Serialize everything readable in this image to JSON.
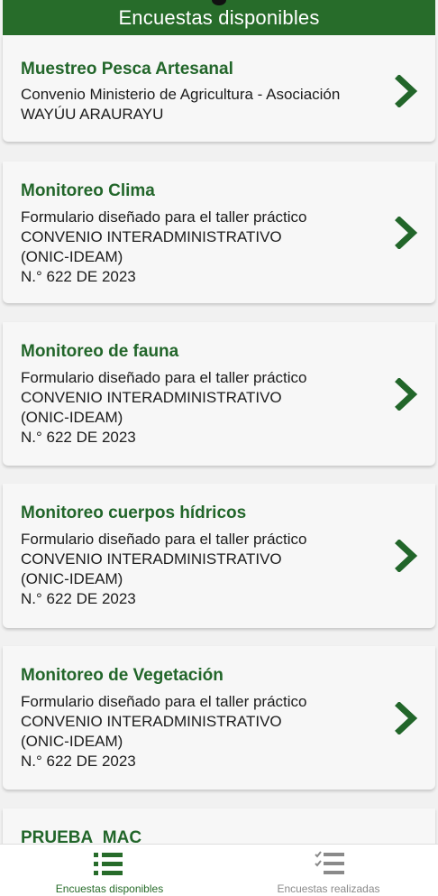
{
  "header": {
    "title": "Encuestas disponibles"
  },
  "surveys": [
    {
      "title": "Muestreo Pesca Artesanal",
      "description": "Convenio Ministerio de Agricultura - Asociación\nWAYÚU ARAURAYU"
    },
    {
      "title": "Monitoreo Clima",
      "description": "Formulario diseñado para el taller práctico\nCONVENIO INTERADMINISTRATIVO\n(ONIC-IDEAM)\nN.° 622 DE 2023"
    },
    {
      "title": "Monitoreo de fauna",
      "description": "Formulario diseñado para el taller práctico\nCONVENIO INTERADMINISTRATIVO\n(ONIC-IDEAM)\nN.° 622 DE 2023"
    },
    {
      "title": "Monitoreo cuerpos hídricos",
      "description": "Formulario diseñado para el taller práctico\nCONVENIO INTERADMINISTRATIVO\n(ONIC-IDEAM)\nN.° 622 DE 2023"
    },
    {
      "title": "Monitoreo de Vegetación",
      "description": "Formulario diseñado para el taller práctico\nCONVENIO INTERADMINISTRATIVO\n(ONIC-IDEAM)\nN.° 622 DE 2023"
    },
    {
      "title": "PRUEBA_MAC",
      "description": ""
    }
  ],
  "bottom_nav": {
    "items": [
      {
        "label": "Encuestas disponibles",
        "icon": "list-icon",
        "active": true
      },
      {
        "label": "Encuestas realizadas",
        "icon": "checklist-icon",
        "active": false
      }
    ]
  },
  "colors": {
    "primary": "#276c2a",
    "title": "#22662a",
    "inactive": "#8a8a8a"
  }
}
